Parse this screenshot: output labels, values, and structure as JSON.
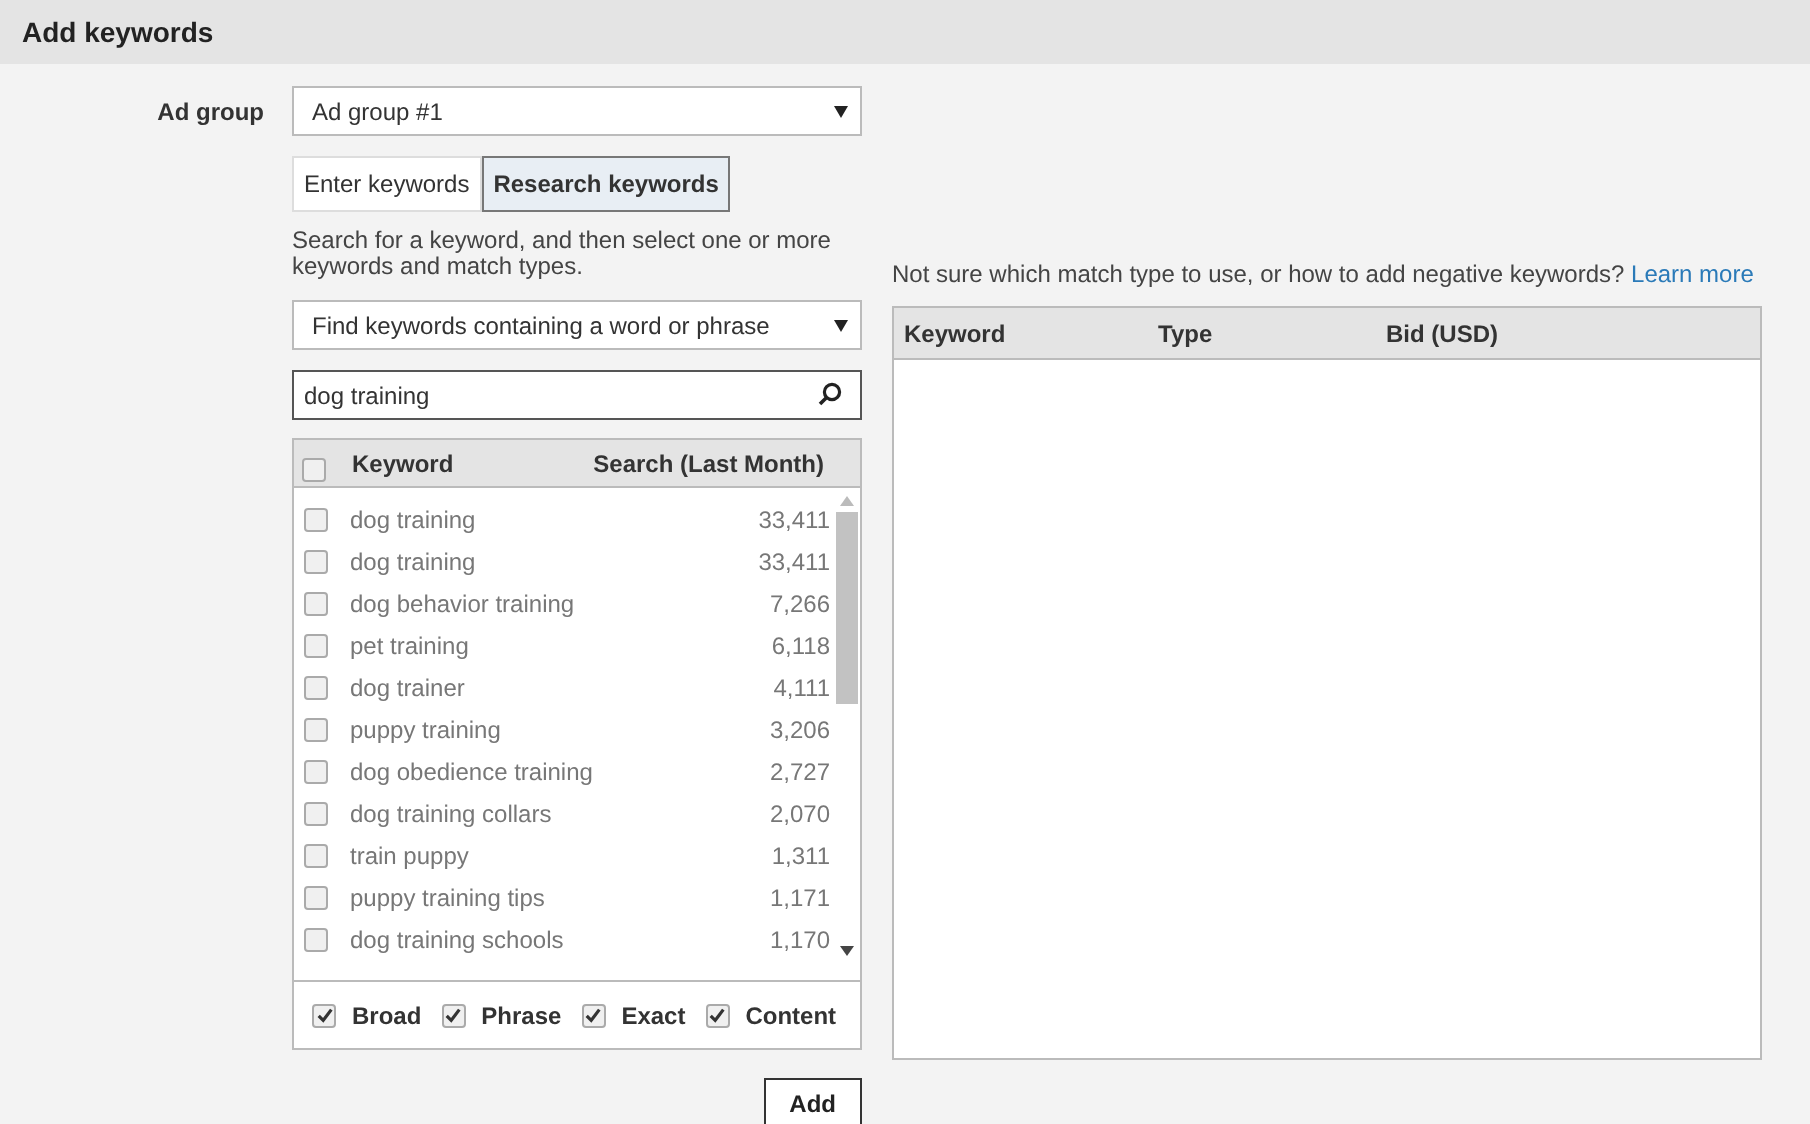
{
  "header": {
    "title": "Add keywords"
  },
  "ad_group": {
    "label": "Ad group",
    "value": "Ad group #1"
  },
  "tabs": [
    {
      "label": "Enter keywords",
      "selected": false
    },
    {
      "label": "Research keywords",
      "selected": true
    }
  ],
  "instructions": "Search for a keyword, and then select one or more keywords and match types.",
  "search_mode": {
    "value": "Find keywords containing a word or phrase"
  },
  "search": {
    "value": "dog training"
  },
  "results": {
    "columns": [
      "Keyword",
      "Search (Last Month)"
    ],
    "select_all_checked": false,
    "rows": [
      {
        "keyword": "dog training",
        "searches": "33,411",
        "checked": false
      },
      {
        "keyword": "dog training",
        "searches": "33,411",
        "checked": false
      },
      {
        "keyword": "dog behavior training",
        "searches": "7,266",
        "checked": false
      },
      {
        "keyword": "pet training",
        "searches": "6,118",
        "checked": false
      },
      {
        "keyword": "dog trainer",
        "searches": "4,111",
        "checked": false
      },
      {
        "keyword": "puppy training",
        "searches": "3,206",
        "checked": false
      },
      {
        "keyword": "dog obedience training",
        "searches": "2,727",
        "checked": false
      },
      {
        "keyword": "dog training collars",
        "searches": "2,070",
        "checked": false
      },
      {
        "keyword": "train puppy",
        "searches": "1,311",
        "checked": false
      },
      {
        "keyword": "puppy training tips",
        "searches": "1,171",
        "checked": false
      },
      {
        "keyword": "dog training schools",
        "searches": "1,170",
        "checked": false
      }
    ]
  },
  "match_types": [
    {
      "label": "Broad",
      "checked": true
    },
    {
      "label": "Phrase",
      "checked": true
    },
    {
      "label": "Exact",
      "checked": true
    },
    {
      "label": "Content",
      "checked": true
    }
  ],
  "add_button": "Add",
  "help": {
    "text": "Not sure which match type to use, or how to add negative keywords?",
    "link": "Learn more"
  },
  "selected_table": {
    "columns": [
      "Keyword",
      "Type",
      "Bid (USD)"
    ]
  }
}
